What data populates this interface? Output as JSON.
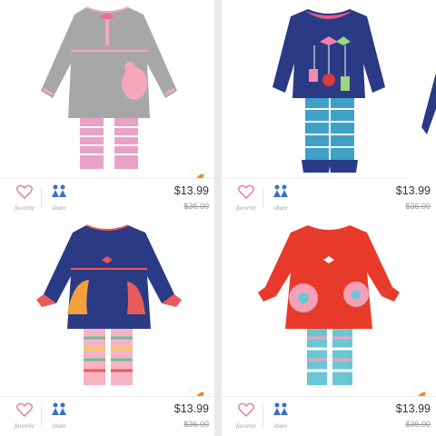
{
  "products": [
    {
      "price": "$13.99",
      "original_price": "$36.00",
      "favorite_label": "favorite",
      "share_label": "share",
      "icon_flash": "rocket-icon"
    },
    {
      "price": "$13.99",
      "original_price": "$36.00",
      "favorite_label": "favorite",
      "share_label": "share",
      "icon_flash": "rocket-icon"
    },
    {
      "price": "$13.99",
      "original_price": "$36.00",
      "favorite_label": "favorite",
      "share_label": "share",
      "icon_flash": "rocket-icon"
    },
    {
      "price": "$13.99",
      "original_price": "$36.00",
      "favorite_label": "favorite",
      "share_label": "share",
      "icon_flash": "rocket-icon"
    }
  ],
  "colors": {
    "heart": "#e8778f",
    "share": "#3a6fc4",
    "rocket": "#f08a24",
    "background": "#e9e9ee"
  }
}
